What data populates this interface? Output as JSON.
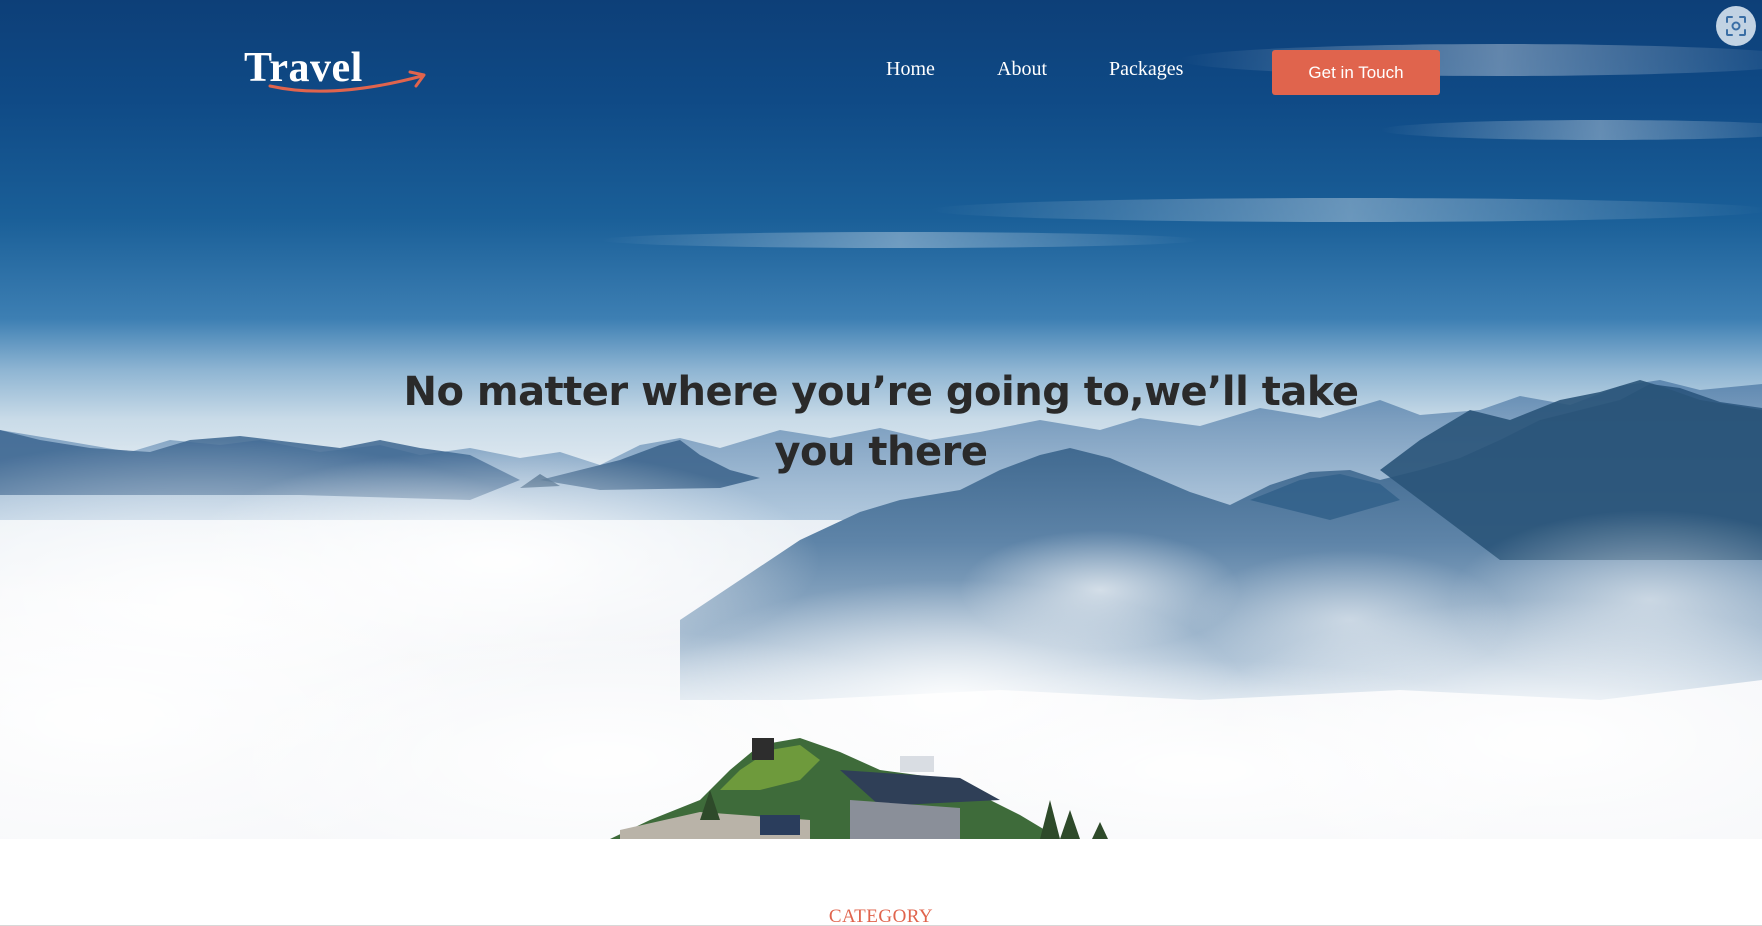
{
  "brand": {
    "logo_text": "Travel"
  },
  "nav": {
    "items": [
      {
        "label": "Home"
      },
      {
        "label": "About"
      },
      {
        "label": "Packages"
      }
    ],
    "cta_label": "Get in Touch"
  },
  "hero": {
    "headline": "No matter where you’re going to,we’ll take you there"
  },
  "section": {
    "category_label": "CATEGORY"
  },
  "icons": {
    "scan": "screenshot-scan-icon",
    "logo_swoosh": "arrow-swoosh-icon"
  },
  "colors": {
    "accent": "#e0644d",
    "sky_top": "#0d3f78",
    "headline_text": "#2a2a2a",
    "nav_text": "#ffffff"
  }
}
